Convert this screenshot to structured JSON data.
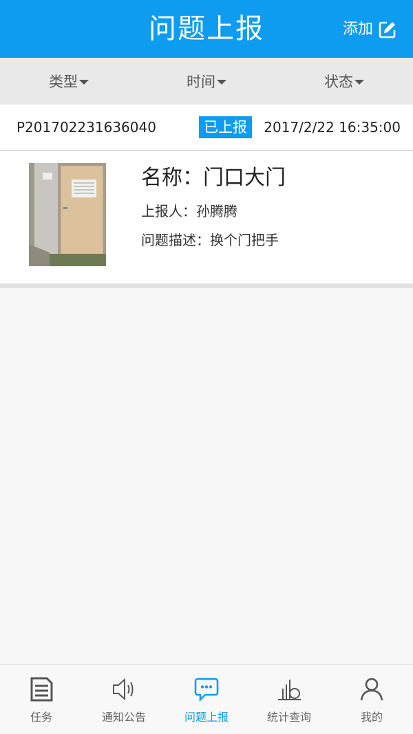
{
  "header": {
    "title": "问题上报",
    "add_label": "添加",
    "add_icon": "edit-icon"
  },
  "filters": [
    {
      "label": "类型",
      "icon": "caret-down-icon"
    },
    {
      "label": "时间",
      "icon": "caret-down-icon"
    },
    {
      "label": "状态",
      "icon": "caret-down-icon"
    }
  ],
  "report": {
    "id": "P201702231636040",
    "status": "已上报",
    "time": "2017/2/22 16:35:00",
    "name_line": "名称：门口大门",
    "reporter_line": "上报人：孙腾腾",
    "description_line": "问题描述：换个门把手"
  },
  "tabbar": {
    "items": [
      {
        "label": "任务",
        "icon": "document-icon",
        "active": false
      },
      {
        "label": "通知公告",
        "icon": "speaker-icon",
        "active": false
      },
      {
        "label": "问题上报",
        "icon": "chat-bubble-icon",
        "active": true
      },
      {
        "label": "统计查询",
        "icon": "statistics-icon",
        "active": false
      },
      {
        "label": "我的",
        "icon": "user-icon",
        "active": false
      }
    ]
  },
  "colors": {
    "accent": "#0e9cf1",
    "filter_bar": "#e9e9e9",
    "background": "#f7f7f7"
  }
}
